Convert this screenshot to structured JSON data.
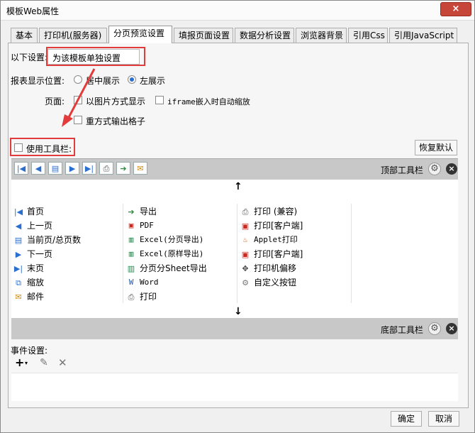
{
  "window": {
    "title": "模板Web属性",
    "close_glyph": "×"
  },
  "tabs": [
    {
      "label": "基本"
    },
    {
      "label": "打印机(服务器)"
    },
    {
      "label": "分页预览设置",
      "active": true
    },
    {
      "label": "填报页面设置"
    },
    {
      "label": "数据分析设置"
    },
    {
      "label": "浏览器背景"
    },
    {
      "label": "引用Css"
    },
    {
      "label": "引用JavaScript"
    }
  ],
  "settings": {
    "scope_label": "以下设置:",
    "scope_value": "为该模板单独设置",
    "position_label": "报表显示位置:",
    "position_options": [
      "居中展示",
      "左展示"
    ],
    "position_selected": "左展示",
    "page_label": "页面:",
    "as_image": "以图片方式显示",
    "iframe_zoom": "iframe嵌入时自动缩放",
    "repeat_grid": "重方式输出格子"
  },
  "toolbar_section": {
    "use_toolbar": "使用工具栏:",
    "restore_default": "恢复默认",
    "top_toolbar": "顶部工具栏",
    "bottom_toolbar": "底部工具栏",
    "up_arrow": "↑",
    "down_arrow": "↓"
  },
  "toolbar_items": {
    "col1": [
      "首页",
      "上一页",
      "当前页/总页数",
      "下一页",
      "末页",
      "缩放",
      "邮件"
    ],
    "col2": [
      "导出",
      "PDF",
      "Excel(分页导出)",
      "Excel(原样导出)",
      "分页分Sheet导出",
      "Word",
      "打印"
    ],
    "col3": [
      "打印 (兼容)",
      "打印[客户端]",
      "Applet打印",
      "打印[客户端]",
      "打印机偏移",
      "自定义按钮"
    ]
  },
  "events": {
    "label": "事件设置:"
  },
  "footer": {
    "ok": "确定",
    "cancel": "取消"
  },
  "colors": {
    "highlight": "#e23b3b",
    "accent": "#2a6fcf"
  }
}
